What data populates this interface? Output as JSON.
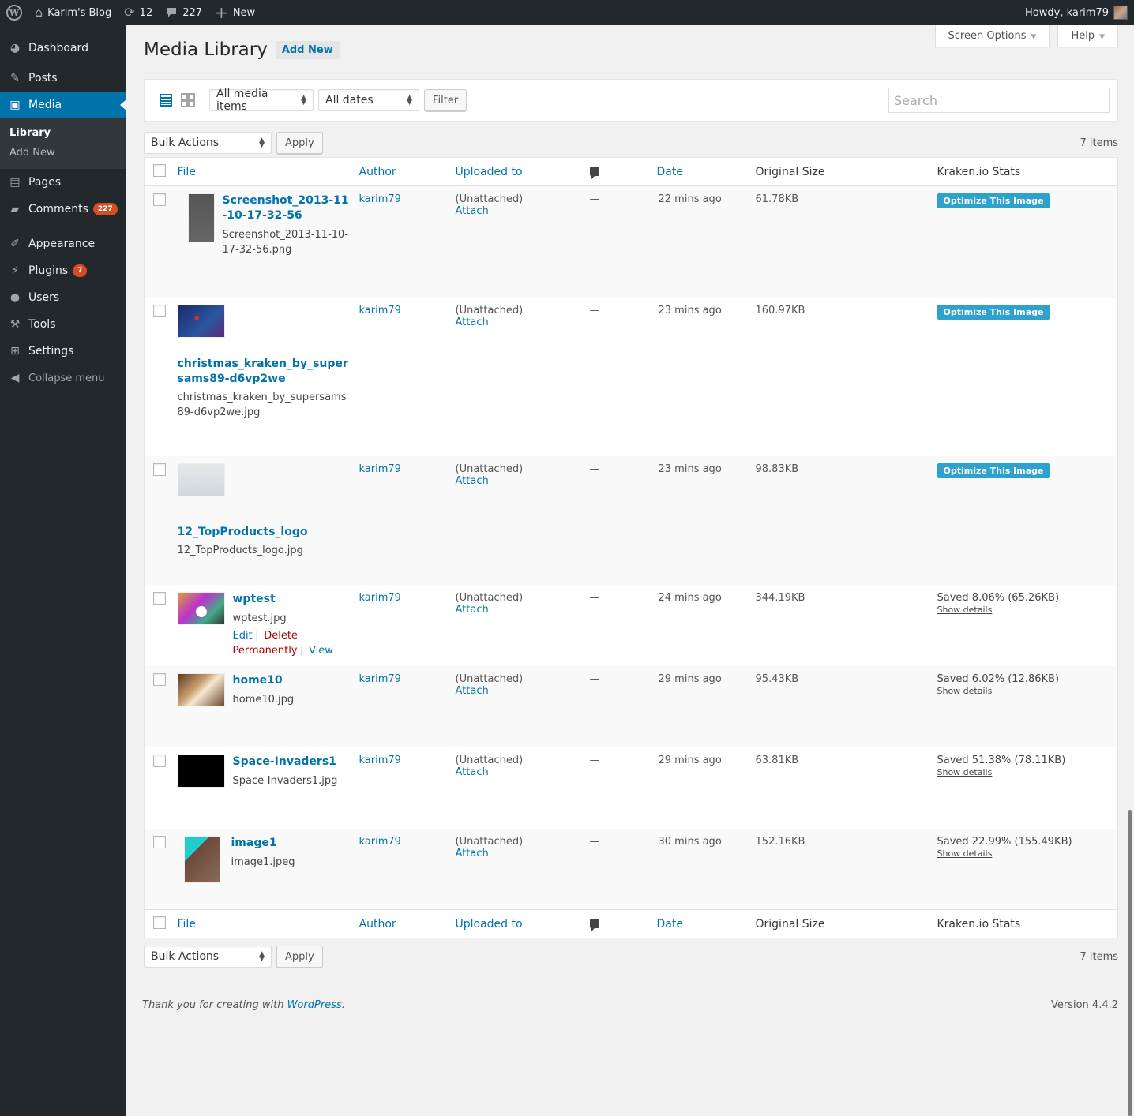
{
  "adminbar": {
    "site_name": "Karim's Blog",
    "updates_count": "12",
    "comments_count": "227",
    "new_label": "New",
    "howdy": "Howdy, karim79"
  },
  "sidebar": {
    "items": [
      {
        "label": "Dashboard",
        "icon": "dashboard-icon"
      },
      {
        "label": "Posts",
        "icon": "pin-icon"
      },
      {
        "label": "Media",
        "icon": "media-icon",
        "current": true
      },
      {
        "label": "Pages",
        "icon": "pages-icon"
      },
      {
        "label": "Comments",
        "icon": "comment-icon",
        "badge": "227"
      },
      {
        "label": "Appearance",
        "icon": "brush-icon"
      },
      {
        "label": "Plugins",
        "icon": "plugin-icon",
        "badge": "7"
      },
      {
        "label": "Users",
        "icon": "user-icon"
      },
      {
        "label": "Tools",
        "icon": "wrench-icon"
      },
      {
        "label": "Settings",
        "icon": "settings-icon"
      }
    ],
    "submenu": [
      "Library",
      "Add New"
    ],
    "collapse": "Collapse menu"
  },
  "header": {
    "title": "Media Library",
    "add_new": "Add New",
    "screen_options": "Screen Options",
    "help": "Help"
  },
  "filters": {
    "media_type": "All media items",
    "dates": "All dates",
    "filter_btn": "Filter",
    "search_placeholder": "Search"
  },
  "tablenav": {
    "bulk_actions": "Bulk Actions",
    "apply": "Apply",
    "count": "7 items"
  },
  "columns": {
    "file": "File",
    "author": "Author",
    "uploaded_to": "Uploaded to",
    "date": "Date",
    "original_size": "Original Size",
    "kraken": "Kraken.io Stats"
  },
  "rows": [
    {
      "title": "Screenshot_2013-11-10-17-32-56",
      "filename": "Screenshot_2013-11-10-17-32-56.png",
      "author": "karim79",
      "uploaded": "(Unattached)",
      "attach": "Attach",
      "comments": "—",
      "date": "22 mins ago",
      "size": "61.78KB",
      "kraken": {
        "button": "Optimize This Image"
      }
    },
    {
      "title": "christmas_kraken_by_supersams89-d6vp2we",
      "filename": "christmas_kraken_by_supersams89-d6vp2we.jpg",
      "author": "karim79",
      "uploaded": "(Unattached)",
      "attach": "Attach",
      "comments": "—",
      "date": "23 mins ago",
      "size": "160.97KB",
      "kraken": {
        "button": "Optimize This Image"
      }
    },
    {
      "title": "12_TopProducts_logo",
      "filename": "12_TopProducts_logo.jpg",
      "author": "karim79",
      "uploaded": "(Unattached)",
      "attach": "Attach",
      "comments": "—",
      "date": "23 mins ago",
      "size": "98.83KB",
      "kraken": {
        "button": "Optimize This Image"
      }
    },
    {
      "title": "wptest",
      "filename": "wptest.jpg",
      "author": "karim79",
      "uploaded": "(Unattached)",
      "attach": "Attach",
      "comments": "—",
      "date": "24 mins ago",
      "size": "344.19KB",
      "kraken": {
        "saved": "Saved 8.06% (65.26KB)",
        "details": "Show details"
      },
      "actions": {
        "edit": "Edit",
        "delete": "Delete Permanently",
        "view": "View"
      }
    },
    {
      "title": "home10",
      "filename": "home10.jpg",
      "author": "karim79",
      "uploaded": "(Unattached)",
      "attach": "Attach",
      "comments": "—",
      "date": "29 mins ago",
      "size": "95.43KB",
      "kraken": {
        "saved": "Saved 6.02% (12.86KB)",
        "details": "Show details"
      }
    },
    {
      "title": "Space-Invaders1",
      "filename": "Space-Invaders1.jpg",
      "author": "karim79",
      "uploaded": "(Unattached)",
      "attach": "Attach",
      "comments": "—",
      "date": "29 mins ago",
      "size": "63.81KB",
      "kraken": {
        "saved": "Saved 51.38% (78.11KB)",
        "details": "Show details"
      }
    },
    {
      "title": "image1",
      "filename": "image1.jpeg",
      "author": "karim79",
      "uploaded": "(Unattached)",
      "attach": "Attach",
      "comments": "—",
      "date": "30 mins ago",
      "size": "152.16KB",
      "kraken": {
        "saved": "Saved 22.99% (155.49KB)",
        "details": "Show details"
      }
    }
  ],
  "footer": {
    "thanks": "Thank you for creating with ",
    "wordpress": "WordPress",
    "period": ".",
    "version": "Version 4.4.2"
  }
}
